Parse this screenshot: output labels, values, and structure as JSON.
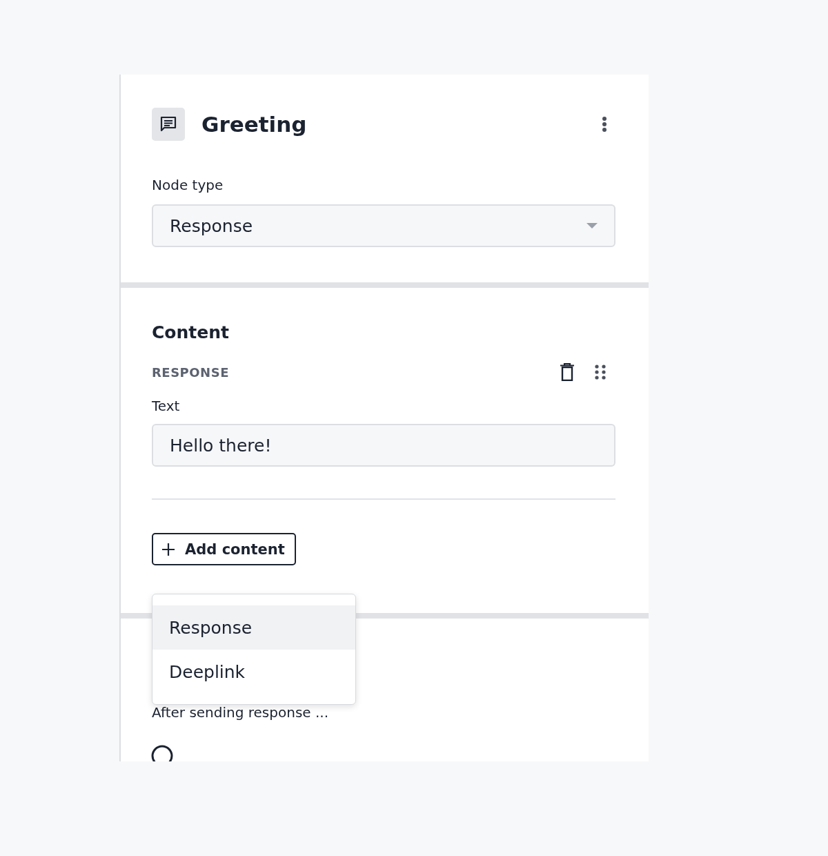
{
  "header": {
    "title": "Greeting"
  },
  "node_type": {
    "label": "Node type",
    "value": "Response"
  },
  "content": {
    "heading": "Content",
    "blocks": [
      {
        "kind": "response",
        "label": "RESPONSE",
        "field_label": "Text",
        "value": "Hello there!"
      }
    ],
    "add_button": "Add content",
    "menu": [
      {
        "label": "Response",
        "selected": true
      },
      {
        "label": "Deeplink",
        "selected": false
      }
    ]
  },
  "after": {
    "label": "After sending response ..."
  }
}
